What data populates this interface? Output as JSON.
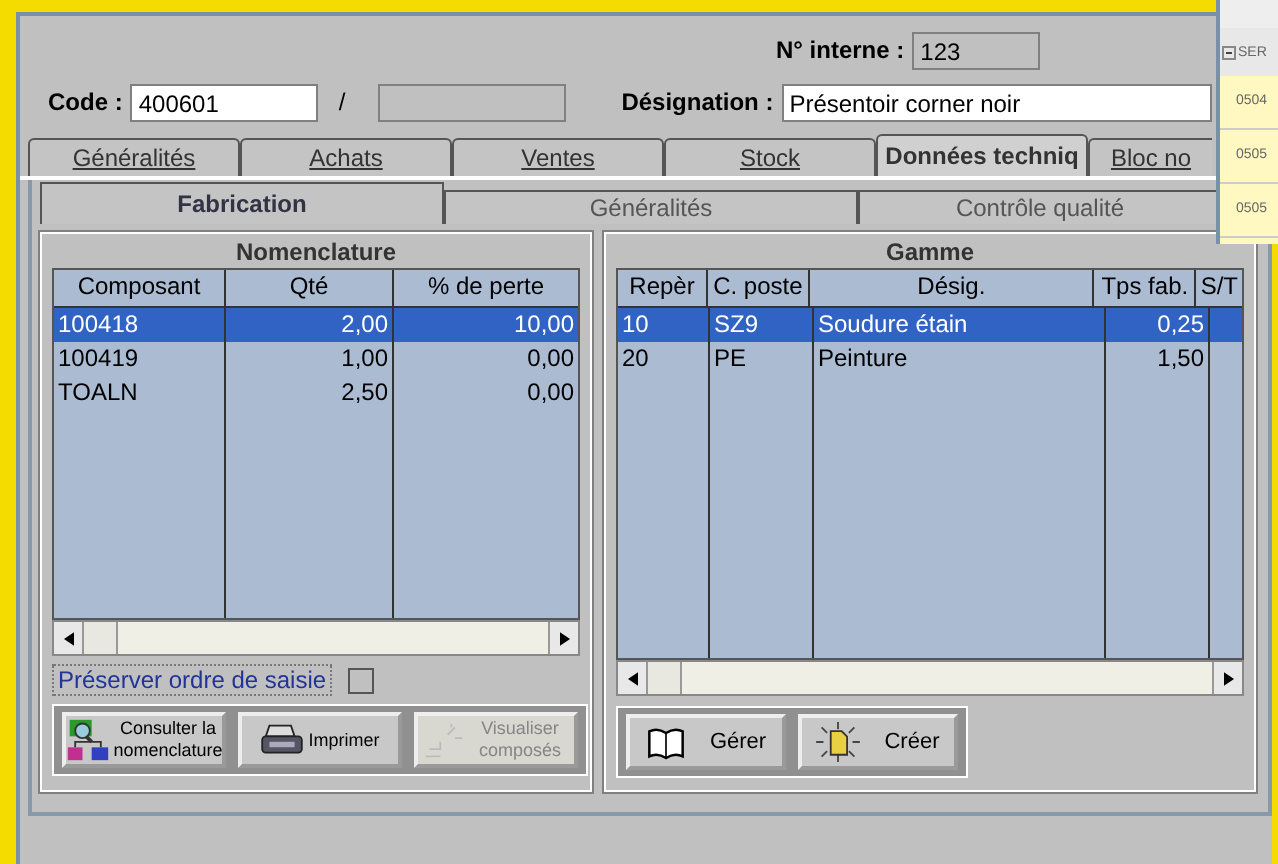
{
  "header": {
    "internal_label": "N° interne :",
    "internal_value": "123",
    "code_label": "Code :",
    "code_value": "400601",
    "separator": "/",
    "designation_label": "Désignation :",
    "designation_value": "Présentoir corner noir"
  },
  "tabs": [
    {
      "label": "Généralités",
      "selected": false
    },
    {
      "label": "Achats",
      "selected": false
    },
    {
      "label": "Ventes",
      "selected": false
    },
    {
      "label": "Stock",
      "selected": false
    },
    {
      "label": "Données techniq",
      "selected": true
    },
    {
      "label": "Bloc no",
      "selected": false
    }
  ],
  "subtabs": [
    {
      "label": "Fabrication",
      "selected": true
    },
    {
      "label": "Généralités",
      "selected": false
    },
    {
      "label": "Contrôle qualité",
      "selected": false
    }
  ],
  "nomenclature": {
    "title": "Nomenclature",
    "columns": [
      "Composant",
      "Qté",
      "% de perte"
    ],
    "rows": [
      {
        "cells": [
          "100418",
          "2,00",
          "10,00"
        ],
        "selected": true
      },
      {
        "cells": [
          "100419",
          "1,00",
          "0,00"
        ],
        "selected": false
      },
      {
        "cells": [
          "TOALN",
          "2,50",
          "0,00"
        ],
        "selected": false
      }
    ],
    "preserve_label": "Préserver ordre de saisie",
    "preserve_checked": false,
    "buttons": [
      {
        "kind": "tree",
        "label": "Consulter la nomenclature",
        "disabled": false
      },
      {
        "kind": "printer",
        "label": "Imprimer",
        "disabled": false
      },
      {
        "kind": "sparkle",
        "label": "Visualiser composés",
        "disabled": true
      }
    ]
  },
  "gamme": {
    "title": "Gamme",
    "columns": [
      "Repèr",
      "C. poste",
      "Désig.",
      "Tps fab.",
      "S/T"
    ],
    "rows": [
      {
        "cells": [
          "10",
          "SZ9",
          "Soudure étain",
          "0,25",
          ""
        ],
        "selected": true
      },
      {
        "cells": [
          "20",
          "PE",
          "Peinture",
          "1,50",
          ""
        ],
        "selected": false
      }
    ],
    "buttons": [
      {
        "kind": "book",
        "label": "Gérer",
        "disabled": false
      },
      {
        "kind": "new",
        "label": "Créer",
        "disabled": false
      }
    ]
  },
  "side_window": {
    "header": "SER",
    "rows": [
      "0504",
      "0505",
      "0505"
    ]
  }
}
